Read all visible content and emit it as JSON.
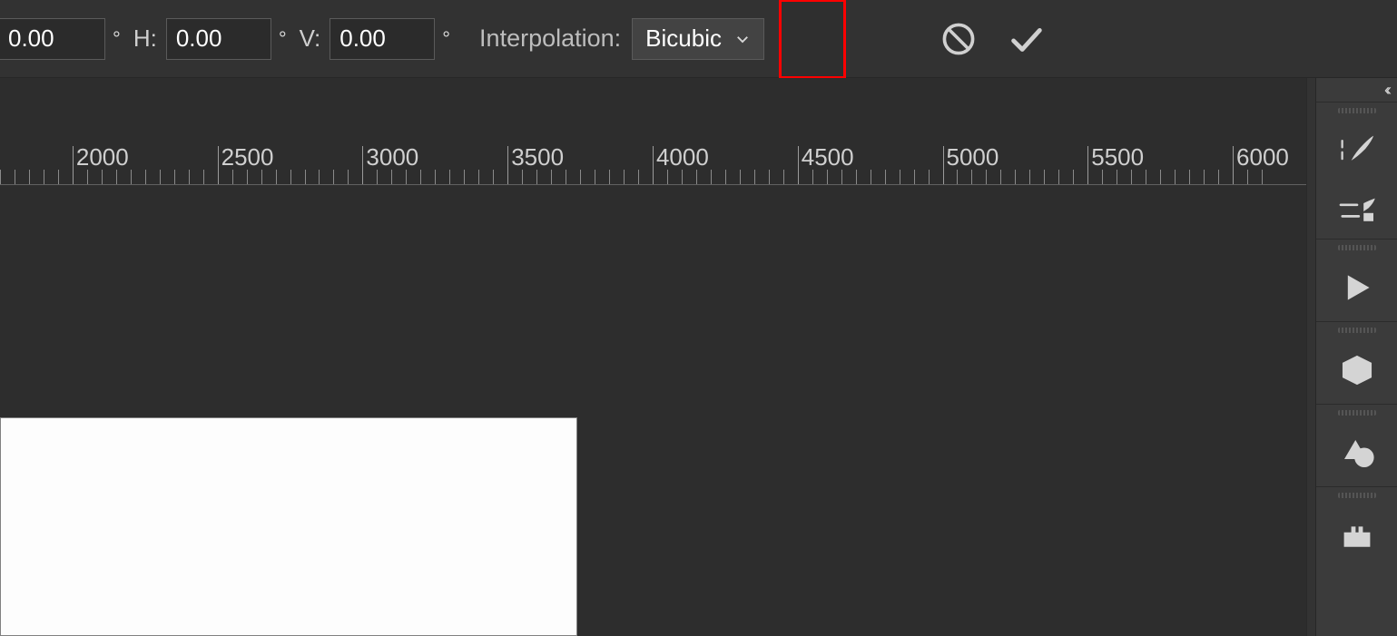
{
  "options": {
    "first_value": "0.00",
    "h_label": "H:",
    "h_value": "0.00",
    "v_label": "V:",
    "v_value": "0.00",
    "degree_symbol": "°",
    "interpolation_label": "Interpolation:",
    "interpolation_value": "Bicubic"
  },
  "ruler": {
    "start": 1750,
    "end": 6100,
    "labels": [
      2000,
      2500,
      3000,
      3500,
      4000,
      4500,
      5000,
      5500,
      6000
    ]
  },
  "right_panel": {
    "collapse_glyph": "‹‹",
    "icons": [
      "brush-presets-icon",
      "clone-source-icon",
      "actions-play-icon",
      "3d-icon",
      "measure-icon",
      "plugins-icon"
    ]
  }
}
